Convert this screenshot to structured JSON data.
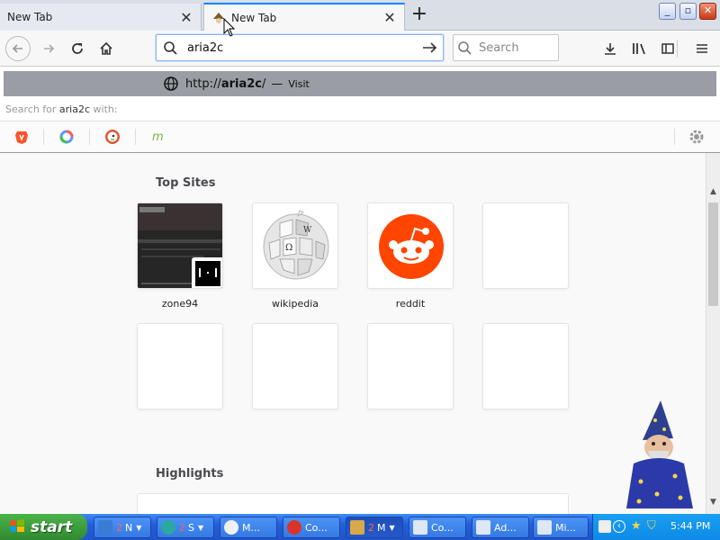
{
  "tabs": [
    {
      "label": "New Tab",
      "active": false
    },
    {
      "label": "New Tab",
      "active": true
    }
  ],
  "window_controls": {
    "minimize": "_",
    "maximize": "▫",
    "close": "✕"
  },
  "toolbar": {
    "url_value": "aria2c",
    "search_placeholder": "Search"
  },
  "dropdown": {
    "suggestion_prefix": "http://",
    "suggestion_host": "aria2c",
    "suggestion_suffix": "/",
    "dash": "—",
    "visit": "Visit",
    "search_for_prefix": "Search for",
    "search_for_query": "aria2c",
    "search_for_suffix": "with:",
    "engines": [
      "brave-icon",
      "qwant-icon",
      "duckduckgo-icon",
      "mojeek-icon"
    ]
  },
  "newtab": {
    "topsites_title": "Top Sites",
    "highlights_title": "Highlights",
    "tiles": [
      {
        "label": "zone94"
      },
      {
        "label": "wikipedia"
      },
      {
        "label": "reddit"
      },
      {
        "label": ""
      },
      {
        "label": ""
      },
      {
        "label": ""
      },
      {
        "label": ""
      },
      {
        "label": ""
      }
    ]
  },
  "taskbar": {
    "start": "start",
    "tasks": [
      {
        "num": "2",
        "label": "N",
        "icon_color": "#3a7bd5"
      },
      {
        "num": "2",
        "label": "S",
        "icon_color": "#2aa9a0"
      },
      {
        "num": "",
        "label": "M...",
        "icon_color": "#f0f0f0"
      },
      {
        "num": "",
        "label": "Co...",
        "icon_color": "#d9342b"
      },
      {
        "num": "2",
        "label": "M",
        "icon_color": "#d8a84a"
      },
      {
        "num": "",
        "label": "Co...",
        "icon_color": "#dfe6f4"
      },
      {
        "num": "",
        "label": "Ad...",
        "icon_color": "#dfe6f4"
      },
      {
        "num": "",
        "label": "Mi...",
        "icon_color": "#dfe6f4"
      }
    ],
    "clock": "5:44 PM"
  },
  "colors": {
    "accent": "#0a84ff",
    "reddit": "#ff4500",
    "taskbar": "#245edb",
    "start": "#2f8a2f"
  }
}
